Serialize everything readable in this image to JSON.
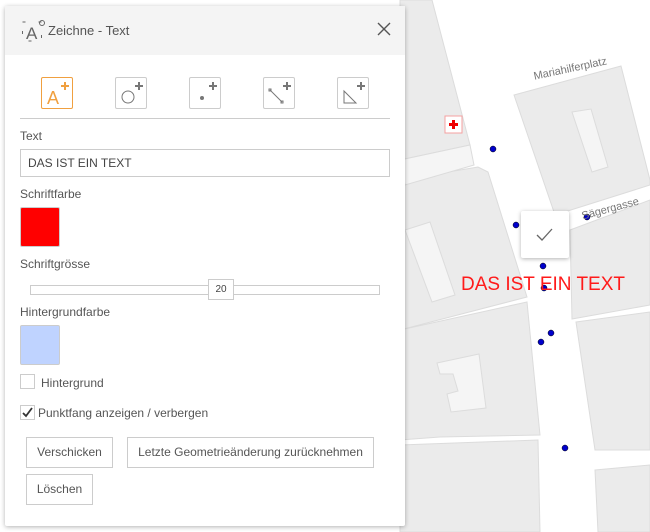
{
  "map": {
    "streets": [
      "Mariahilferplatz",
      "Sägergasse"
    ],
    "drawn_text": "DAS IST EIN TEXT",
    "drawn_text_color": "#ff1a1a",
    "point_color": "#0000cc"
  },
  "panel": {
    "title": "Zeichne - Text",
    "tools": [
      "text-add",
      "circle-add",
      "point-add",
      "line-add",
      "polygon-add"
    ],
    "text_label": "Text",
    "text_value": "DAS IST EIN TEXT",
    "font_color_label": "Schriftfarbe",
    "font_color": "#ff0000",
    "font_size_label": "Schriftgrösse",
    "font_size": "20",
    "bg_color_label": "Hintergrundfarbe",
    "bg_color": "#bfd3ff",
    "bg_checkbox_label": "Hintergrund",
    "bg_checked": false,
    "snap_label": "Punktfang anzeigen / verbergen",
    "snap_checked": true,
    "buttons": {
      "send": "Verschicken",
      "undo": "Letzte Geometrieänderung zurücknehmen",
      "delete": "Löschen"
    }
  }
}
